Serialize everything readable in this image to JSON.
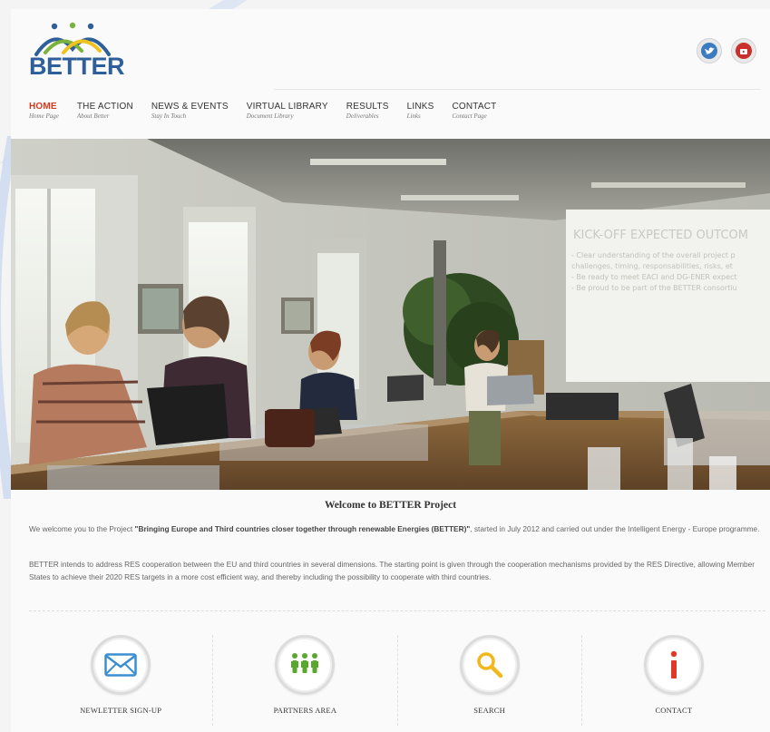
{
  "brand": {
    "logo_text": "BETTER"
  },
  "colors": {
    "accent": "#d23a1e",
    "brand_blue": "#2f5f9a",
    "brand_green": "#7bb23a",
    "brand_yellow": "#f0c21f"
  },
  "social": [
    {
      "name": "twitter",
      "icon": "twitter-bird-icon"
    },
    {
      "name": "youtube",
      "icon": "youtube-icon"
    }
  ],
  "nav": [
    {
      "label": "HOME",
      "sub": "Home Page",
      "active": true
    },
    {
      "label": "THE ACTION",
      "sub": "About Better"
    },
    {
      "label": "NEWS & EVENTS",
      "sub": "Stay In Touch"
    },
    {
      "label": "VIRTUAL LIBRARY",
      "sub": "Document Library"
    },
    {
      "label": "RESULTS",
      "sub": "Deliverables"
    },
    {
      "label": "LINKS",
      "sub": "Links"
    },
    {
      "label": "CONTACT",
      "sub": "Contact Page"
    }
  ],
  "hero": {
    "slide_title": "KICK-OFF EXPECTED OUTCOM",
    "slide_lines": [
      "- Clear understanding of the overall project p",
      "  challenges, timing, responsabilities, risks, et",
      "- Be ready to meet EACI and DG-ENER expect",
      "- Be proud to be part of the BETTER consortiu"
    ]
  },
  "content": {
    "welcome_title": "Welcome to BETTER Project",
    "para1_prefix": "We welcome you to the Project ",
    "para1_bold": "\"Bringing Europe and Third countries closer together through renewable Energies (BETTER)\"",
    "para1_suffix": ", started in July 2012 and carried out under the Intelligent Energy - Europe programme.",
    "para2": "BETTER intends to address RES cooperation between the EU and third countries in several dimensions. The starting point is given through the cooperation mechanisms provided by the RES Directive, allowing Member States to achieve their 2020 RES targets in a more cost efficient way, and thereby including the possibility to cooperate with third countries."
  },
  "features": [
    {
      "label": "NEWLETTER SIGN-UP",
      "icon": "envelope-icon"
    },
    {
      "label": "PARTNERS AREA",
      "icon": "people-icon"
    },
    {
      "label": "SEARCH",
      "icon": "search-icon"
    },
    {
      "label": "CONTACT",
      "icon": "info-icon"
    }
  ]
}
